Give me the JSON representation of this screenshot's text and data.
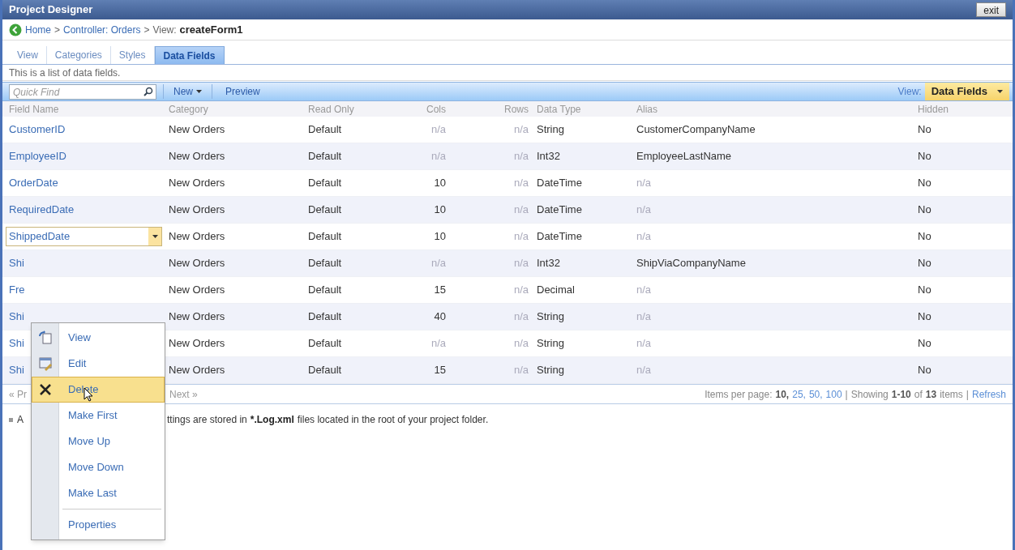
{
  "window": {
    "title": "Project Designer",
    "exit_button": "exit"
  },
  "breadcrumb": [
    {
      "kind": "link",
      "text": "Home"
    },
    {
      "kind": "text",
      "text": ">"
    },
    {
      "kind": "link",
      "text": "Controller: Orders"
    },
    {
      "kind": "text",
      "text": ">"
    },
    {
      "kind": "text",
      "text": "View:"
    },
    {
      "kind": "bold",
      "text": "createForm1"
    }
  ],
  "tabs": [
    {
      "label": "View",
      "selected": false
    },
    {
      "label": "Categories",
      "selected": false
    },
    {
      "label": "Styles",
      "selected": false
    },
    {
      "label": "Data Fields",
      "selected": true
    }
  ],
  "description": "This is a list of data fields.",
  "toolbar": {
    "search": {
      "placeholder": "Quick Find"
    },
    "new_button": "New",
    "preview_button": "Preview",
    "view_label": "View:",
    "view_select": "Data Fields"
  },
  "table": {
    "columns": [
      "Field Name",
      "Category",
      "Read Only",
      "Cols",
      "Rows",
      "Data Type",
      "Alias",
      "Hidden"
    ],
    "rows": [
      {
        "selected": false,
        "cells": [
          {
            "text": "CustomerID",
            "dim": false
          },
          {
            "text": "New Orders",
            "dim": false
          },
          {
            "text": "Default",
            "dim": false
          },
          {
            "text": "n/a",
            "dim": true
          },
          {
            "text": "n/a",
            "dim": true
          },
          {
            "text": "String",
            "dim": false
          },
          {
            "text": "CustomerCompanyName",
            "dim": false
          },
          {
            "text": "No",
            "dim": false
          }
        ]
      },
      {
        "selected": false,
        "cells": [
          {
            "text": "EmployeeID",
            "dim": false
          },
          {
            "text": "New Orders",
            "dim": false
          },
          {
            "text": "Default",
            "dim": false
          },
          {
            "text": "n/a",
            "dim": true
          },
          {
            "text": "n/a",
            "dim": true
          },
          {
            "text": "Int32",
            "dim": false
          },
          {
            "text": "EmployeeLastName",
            "dim": false
          },
          {
            "text": "No",
            "dim": false
          }
        ]
      },
      {
        "selected": false,
        "cells": [
          {
            "text": "OrderDate",
            "dim": false
          },
          {
            "text": "New Orders",
            "dim": false
          },
          {
            "text": "Default",
            "dim": false
          },
          {
            "text": "10",
            "dim": false
          },
          {
            "text": "n/a",
            "dim": true
          },
          {
            "text": "DateTime",
            "dim": false
          },
          {
            "text": "n/a",
            "dim": true
          },
          {
            "text": "No",
            "dim": false
          }
        ]
      },
      {
        "selected": false,
        "cells": [
          {
            "text": "RequiredDate",
            "dim": false
          },
          {
            "text": "New Orders",
            "dim": false
          },
          {
            "text": "Default",
            "dim": false
          },
          {
            "text": "10",
            "dim": false
          },
          {
            "text": "n/a",
            "dim": true
          },
          {
            "text": "DateTime",
            "dim": false
          },
          {
            "text": "n/a",
            "dim": true
          },
          {
            "text": "No",
            "dim": false
          }
        ]
      },
      {
        "selected": true,
        "cells": [
          {
            "text": "ShippedDate",
            "dim": false
          },
          {
            "text": "New Orders",
            "dim": false
          },
          {
            "text": "Default",
            "dim": false
          },
          {
            "text": "10",
            "dim": false
          },
          {
            "text": "n/a",
            "dim": true
          },
          {
            "text": "DateTime",
            "dim": false
          },
          {
            "text": "n/a",
            "dim": true
          },
          {
            "text": "No",
            "dim": false
          }
        ]
      },
      {
        "selected": false,
        "cells": [
          {
            "text": "Shi",
            "dim": false
          },
          {
            "text": "New Orders",
            "dim": false
          },
          {
            "text": "Default",
            "dim": false
          },
          {
            "text": "n/a",
            "dim": true
          },
          {
            "text": "n/a",
            "dim": true
          },
          {
            "text": "Int32",
            "dim": false
          },
          {
            "text": "ShipViaCompanyName",
            "dim": false
          },
          {
            "text": "No",
            "dim": false
          }
        ]
      },
      {
        "selected": false,
        "cells": [
          {
            "text": "Fre",
            "dim": false
          },
          {
            "text": "New Orders",
            "dim": false
          },
          {
            "text": "Default",
            "dim": false
          },
          {
            "text": "15",
            "dim": false
          },
          {
            "text": "n/a",
            "dim": true
          },
          {
            "text": "Decimal",
            "dim": false
          },
          {
            "text": "n/a",
            "dim": true
          },
          {
            "text": "No",
            "dim": false
          }
        ]
      },
      {
        "selected": false,
        "cells": [
          {
            "text": "Shi",
            "dim": false
          },
          {
            "text": "New Orders",
            "dim": false
          },
          {
            "text": "Default",
            "dim": false
          },
          {
            "text": "40",
            "dim": false
          },
          {
            "text": "n/a",
            "dim": true
          },
          {
            "text": "String",
            "dim": false
          },
          {
            "text": "n/a",
            "dim": true
          },
          {
            "text": "No",
            "dim": false
          }
        ]
      },
      {
        "selected": false,
        "cells": [
          {
            "text": "Shi",
            "dim": false
          },
          {
            "text": "New Orders",
            "dim": false
          },
          {
            "text": "Default",
            "dim": false
          },
          {
            "text": "n/a",
            "dim": true
          },
          {
            "text": "n/a",
            "dim": true
          },
          {
            "text": "String",
            "dim": false
          },
          {
            "text": "n/a",
            "dim": true
          },
          {
            "text": "No",
            "dim": false
          }
        ]
      },
      {
        "selected": false,
        "cells": [
          {
            "text": "Shi",
            "dim": false
          },
          {
            "text": "New Orders",
            "dim": false
          },
          {
            "text": "Default",
            "dim": false
          },
          {
            "text": "15",
            "dim": false
          },
          {
            "text": "n/a",
            "dim": true
          },
          {
            "text": "String",
            "dim": false
          },
          {
            "text": "n/a",
            "dim": true
          },
          {
            "text": "No",
            "dim": false
          }
        ]
      }
    ]
  },
  "pager": {
    "previous": "« Pr",
    "next": "Next »",
    "summary": [
      {
        "kind": "text",
        "text": "Items per page:"
      },
      {
        "kind": "bold",
        "text": "10,"
      },
      {
        "kind": "link",
        "text": "25,"
      },
      {
        "kind": "link",
        "text": "50,"
      },
      {
        "kind": "link",
        "text": "100"
      },
      {
        "kind": "text",
        "text": "|"
      },
      {
        "kind": "text",
        "text": "Showing"
      },
      {
        "kind": "bold",
        "text": "1-10"
      },
      {
        "kind": "text",
        "text": "of"
      },
      {
        "kind": "bold",
        "text": "13"
      },
      {
        "kind": "text",
        "text": "items"
      },
      {
        "kind": "text",
        "text": "|"
      },
      {
        "kind": "link",
        "text": "Refresh"
      }
    ]
  },
  "note": {
    "start": "A",
    "rest": [
      {
        "kind": "text",
        "text": "ttings are stored in"
      },
      {
        "kind": "bold",
        "text": "*.Log.xml"
      },
      {
        "kind": "text",
        "text": "files located in the root of your project folder."
      }
    ]
  },
  "context_menu": [
    {
      "label": "View",
      "selected": false,
      "separator_before": false
    },
    {
      "label": "Edit",
      "selected": false,
      "separator_before": false
    },
    {
      "label": "Delete",
      "selected": true,
      "separator_before": false
    },
    {
      "label": "Make First",
      "selected": false,
      "separator_before": false
    },
    {
      "label": "Move Up",
      "selected": false,
      "separator_before": false
    },
    {
      "label": "Move Down",
      "selected": false,
      "separator_before": false
    },
    {
      "label": "Make Last",
      "selected": false,
      "separator_before": false
    },
    {
      "label": "Properties",
      "selected": false,
      "separator_before": true
    }
  ]
}
